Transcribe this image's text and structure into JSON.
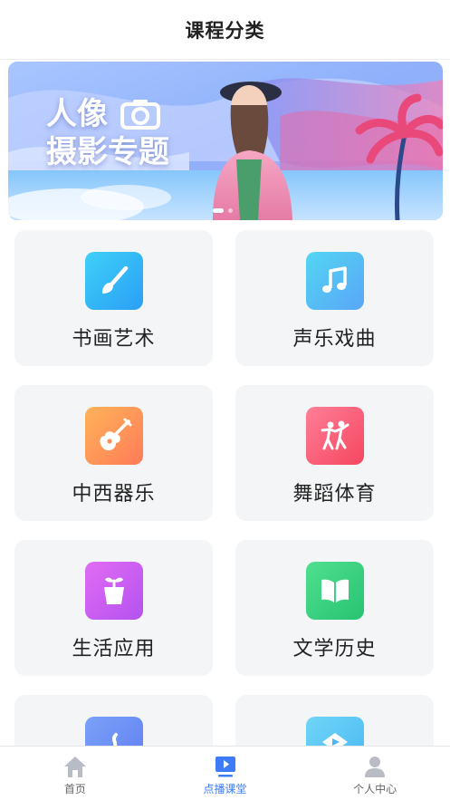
{
  "header": {
    "title": "课程分类"
  },
  "banner": {
    "line1": "人像",
    "line2": "摄影专题",
    "camera_icon": "camera-icon"
  },
  "categories": [
    {
      "label": "书画艺术",
      "icon": "brush-icon",
      "gradient": [
        "#3fd0f8",
        "#2a9ff5"
      ]
    },
    {
      "label": "声乐戏曲",
      "icon": "music-note-icon",
      "gradient": [
        "#52d6f2",
        "#5aa6f7"
      ]
    },
    {
      "label": "中西器乐",
      "icon": "guitar-icon",
      "gradient": [
        "#ffb35a",
        "#ff7b57"
      ]
    },
    {
      "label": "舞蹈体育",
      "icon": "dancers-icon",
      "gradient": [
        "#ff7e97",
        "#f5475f"
      ]
    },
    {
      "label": "生活应用",
      "icon": "plant-pot-icon",
      "gradient": [
        "#e16cf3",
        "#b452f0"
      ]
    },
    {
      "label": "文学历史",
      "icon": "book-icon",
      "gradient": [
        "#4fe08f",
        "#27c372"
      ]
    },
    {
      "label": "",
      "icon": "more-icon",
      "gradient": [
        "#7aa2f8",
        "#5f7df2"
      ]
    },
    {
      "label": "",
      "icon": "video-icon",
      "gradient": [
        "#6fd6f7",
        "#4ab6f2"
      ]
    }
  ],
  "tabbar": {
    "items": [
      {
        "label": "首页",
        "icon": "home-icon"
      },
      {
        "label": "点播课堂",
        "icon": "play-screen-icon",
        "active": true
      },
      {
        "label": "个人中心",
        "icon": "person-icon"
      }
    ],
    "active_color": "#3d7cf6",
    "inactive_color": "#666666"
  }
}
